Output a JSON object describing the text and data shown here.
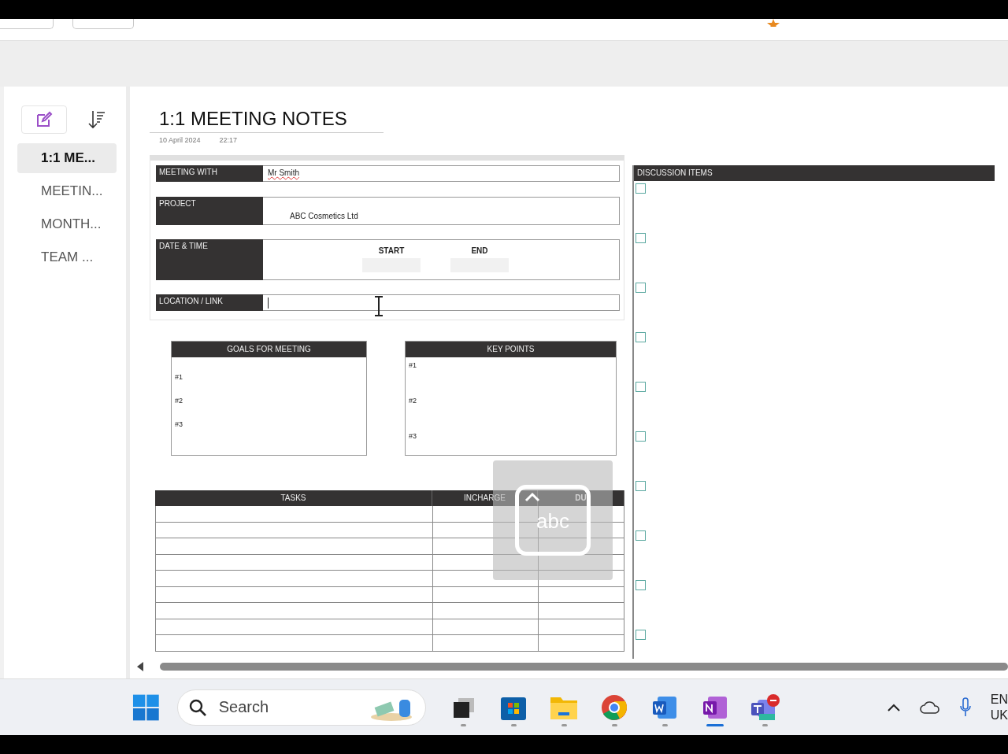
{
  "pages": [
    {
      "label": "1:1 ME...",
      "selected": true
    },
    {
      "label": "MEETIN...",
      "selected": false
    },
    {
      "label": "MONTH...",
      "selected": false
    },
    {
      "label": "TEAM ...",
      "selected": false
    }
  ],
  "note": {
    "title": "1:1 MEETING NOTES",
    "date": "10 April 2024",
    "time": "22:17"
  },
  "form": {
    "meeting_with": {
      "label": "MEETING WITH",
      "value": "Mr Smith"
    },
    "project": {
      "label": "PROJECT",
      "value": "ABC Cosmetics Ltd"
    },
    "date_time": {
      "label": "DATE & TIME",
      "start": "START",
      "end": "END"
    },
    "location": {
      "label": "LOCATION / LINK"
    }
  },
  "goals": {
    "title": "GOALS FOR MEETING",
    "items": [
      "#1",
      "#2",
      "#3"
    ]
  },
  "key_points": {
    "title": "KEY POINTS",
    "items": [
      "#1",
      "#2",
      "#3"
    ]
  },
  "tasks": {
    "columns": [
      "TASKS",
      "INCHARGE",
      "DU"
    ]
  },
  "handwriting_button": {
    "label": "abc"
  },
  "discussion": {
    "title": "DISCUSSION ITEMS",
    "items": [
      {
        "checked": false
      },
      {
        "checked": false
      },
      {
        "checked": false
      },
      {
        "checked": false
      },
      {
        "checked": false
      },
      {
        "checked": false
      },
      {
        "checked": false
      },
      {
        "checked": false
      },
      {
        "checked": false
      },
      {
        "checked": false
      }
    ]
  },
  "taskbar": {
    "search": {
      "placeholder": "Search"
    },
    "apps": [
      {
        "kind": "taskview",
        "selected": false
      },
      {
        "kind": "store",
        "selected": false
      },
      {
        "kind": "files",
        "selected": false
      },
      {
        "kind": "chrome",
        "selected": false
      },
      {
        "kind": "word",
        "selected": false
      },
      {
        "kind": "onenote",
        "selected": true
      },
      {
        "kind": "teams",
        "selected": false
      }
    ],
    "language": [
      "EN",
      "UK"
    ]
  }
}
